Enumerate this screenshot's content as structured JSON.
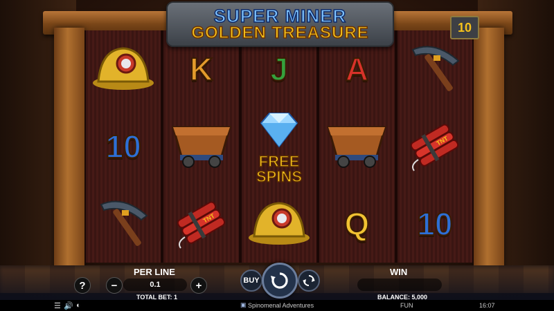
{
  "title": {
    "line1": "SUPER MINER",
    "line2": "GOLDEN TREASURE"
  },
  "lines_badge": "10",
  "reels": [
    [
      {
        "type": "icon",
        "name": "miner-helmet"
      },
      {
        "type": "text",
        "value": "10"
      },
      {
        "type": "icon",
        "name": "pickaxe"
      }
    ],
    [
      {
        "type": "text",
        "value": "K"
      },
      {
        "type": "icon",
        "name": "mine-cart"
      },
      {
        "type": "icon",
        "name": "dynamite"
      }
    ],
    [
      {
        "type": "text",
        "value": "J"
      },
      {
        "type": "scatter",
        "name": "diamond",
        "label1": "FREE",
        "label2": "SPINS"
      },
      {
        "type": "icon",
        "name": "miner-helmet"
      }
    ],
    [
      {
        "type": "text",
        "value": "A"
      },
      {
        "type": "icon",
        "name": "mine-cart"
      },
      {
        "type": "text",
        "value": "Q"
      }
    ],
    [
      {
        "type": "icon",
        "name": "pickaxe"
      },
      {
        "type": "icon",
        "name": "dynamite"
      },
      {
        "type": "text",
        "value": "10"
      }
    ]
  ],
  "controls": {
    "help": "?",
    "per_line_label": "PER LINE",
    "per_line_value": "0.1",
    "minus": "−",
    "plus": "+",
    "total_bet": "TOTAL BET: 1",
    "buy": "BUY",
    "win_label": "WIN",
    "balance": "BALANCE: 5,000"
  },
  "status_bar": {
    "provider": "Spinomenal Adventures",
    "mode": "FUN",
    "time": "16:07"
  },
  "colors": {
    "accent": "#f5c21b",
    "spin_ring": "#6b7d9c"
  }
}
